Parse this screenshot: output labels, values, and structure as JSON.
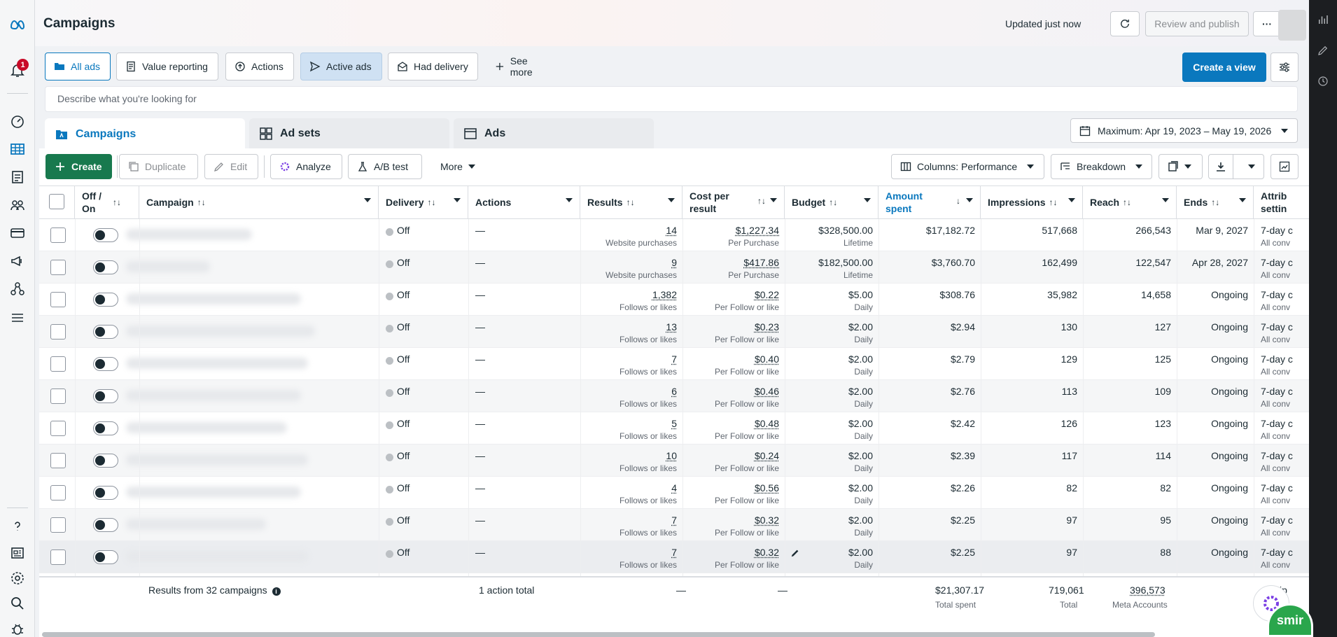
{
  "header": {
    "title": "Campaigns",
    "updated": "Updated just now",
    "review_publish": "Review and publish",
    "more_glyph": "···"
  },
  "rail": {
    "notification_count": "1",
    "icons": [
      "meta-logo-icon",
      "notification-bell-icon",
      "dashboard-gauge-icon",
      "table-grid-icon",
      "pages-icon",
      "audience-icon",
      "billing-card-icon",
      "megaphone-icon",
      "network-icon",
      "menu-icon",
      "help-icon",
      "news-icon",
      "settings-gear-icon",
      "search-icon",
      "bug-icon"
    ]
  },
  "views": {
    "items": [
      {
        "label": "All ads",
        "icon": "folder-icon",
        "selected": true
      },
      {
        "label": "Value reporting",
        "icon": "report-icon"
      },
      {
        "label": "Actions",
        "icon": "actions-icon"
      },
      {
        "label": "Active ads",
        "icon": "send-icon",
        "highlight": true
      },
      {
        "label": "Had delivery",
        "icon": "envelope-icon"
      },
      {
        "label": "See more",
        "icon": "plus-icon"
      }
    ],
    "create_view": "Create a view"
  },
  "search": {
    "placeholder": "Describe what you're looking for"
  },
  "levels": {
    "campaigns": "Campaigns",
    "adsets": "Ad sets",
    "ads": "Ads"
  },
  "date_range": "Maximum: Apr 19, 2023 – May 19, 2026",
  "toolbar": {
    "create": "Create",
    "duplicate": "Duplicate",
    "edit": "Edit",
    "analyze": "Analyze",
    "ab_test": "A/B test",
    "more": "More",
    "columns": "Columns: Performance",
    "breakdown": "Breakdown"
  },
  "columns": {
    "offon": [
      "Off /",
      "On"
    ],
    "campaign": "Campaign",
    "delivery": "Delivery",
    "actions": "Actions",
    "results": "Results",
    "cpr": [
      "Cost per",
      "result"
    ],
    "budget": "Budget",
    "amount": [
      "Amount",
      "spent"
    ],
    "impressions": "Impressions",
    "reach": "Reach",
    "ends": "Ends",
    "attrib": [
      "Attrib",
      "settin"
    ]
  },
  "rows": [
    {
      "delivery": "Off",
      "actions": "—",
      "results": "14",
      "results_sub": "Website purchases",
      "cpr": "$1,227.34",
      "cpr_sub": "Per Purchase",
      "budget": "$328,500.00",
      "budget_sub": "Lifetime",
      "amount": "$17,182.72",
      "impressions": "517,668",
      "reach": "266,543",
      "ends": "Mar 9, 2027",
      "attrib": "7-day c",
      "attrib_sub": "All conv"
    },
    {
      "delivery": "Off",
      "actions": "—",
      "results": "9",
      "results_sub": "Website purchases",
      "cpr": "$417.86",
      "cpr_sub": "Per Purchase",
      "budget": "$182,500.00",
      "budget_sub": "Lifetime",
      "amount": "$3,760.70",
      "impressions": "162,499",
      "reach": "122,547",
      "ends": "Apr 28, 2027",
      "attrib": "7-day c",
      "attrib_sub": "All conv"
    },
    {
      "delivery": "Off",
      "actions": "—",
      "results": "1,382",
      "results_sub": "Follows or likes",
      "cpr": "$0.22",
      "cpr_sub": "Per Follow or like",
      "budget": "$5.00",
      "budget_sub": "Daily",
      "amount": "$308.76",
      "impressions": "35,982",
      "reach": "14,658",
      "ends": "Ongoing",
      "attrib": "7-day c",
      "attrib_sub": "All conv"
    },
    {
      "delivery": "Off",
      "actions": "—",
      "results": "13",
      "results_sub": "Follows or likes",
      "cpr": "$0.23",
      "cpr_sub": "Per Follow or like",
      "budget": "$2.00",
      "budget_sub": "Daily",
      "amount": "$2.94",
      "impressions": "130",
      "reach": "127",
      "ends": "Ongoing",
      "attrib": "7-day c",
      "attrib_sub": "All conv"
    },
    {
      "delivery": "Off",
      "actions": "—",
      "results": "7",
      "results_sub": "Follows or likes",
      "cpr": "$0.40",
      "cpr_sub": "Per Follow or like",
      "budget": "$2.00",
      "budget_sub": "Daily",
      "amount": "$2.79",
      "impressions": "129",
      "reach": "125",
      "ends": "Ongoing",
      "attrib": "7-day c",
      "attrib_sub": "All conv"
    },
    {
      "delivery": "Off",
      "actions": "—",
      "results": "6",
      "results_sub": "Follows or likes",
      "cpr": "$0.46",
      "cpr_sub": "Per Follow or like",
      "budget": "$2.00",
      "budget_sub": "Daily",
      "amount": "$2.76",
      "impressions": "113",
      "reach": "109",
      "ends": "Ongoing",
      "attrib": "7-day c",
      "attrib_sub": "All conv"
    },
    {
      "delivery": "Off",
      "actions": "—",
      "results": "5",
      "results_sub": "Follows or likes",
      "cpr": "$0.48",
      "cpr_sub": "Per Follow or like",
      "budget": "$2.00",
      "budget_sub": "Daily",
      "amount": "$2.42",
      "impressions": "126",
      "reach": "123",
      "ends": "Ongoing",
      "attrib": "7-day c",
      "attrib_sub": "All conv"
    },
    {
      "delivery": "Off",
      "actions": "—",
      "results": "10",
      "results_sub": "Follows or likes",
      "cpr": "$0.24",
      "cpr_sub": "Per Follow or like",
      "budget": "$2.00",
      "budget_sub": "Daily",
      "amount": "$2.39",
      "impressions": "117",
      "reach": "114",
      "ends": "Ongoing",
      "attrib": "7-day c",
      "attrib_sub": "All conv"
    },
    {
      "delivery": "Off",
      "actions": "—",
      "results": "4",
      "results_sub": "Follows or likes",
      "cpr": "$0.56",
      "cpr_sub": "Per Follow or like",
      "budget": "$2.00",
      "budget_sub": "Daily",
      "amount": "$2.26",
      "impressions": "82",
      "reach": "82",
      "ends": "Ongoing",
      "attrib": "7-day c",
      "attrib_sub": "All conv"
    },
    {
      "delivery": "Off",
      "actions": "—",
      "results": "7",
      "results_sub": "Follows or likes",
      "cpr": "$0.32",
      "cpr_sub": "Per Follow or like",
      "budget": "$2.00",
      "budget_sub": "Daily",
      "amount": "$2.25",
      "impressions": "97",
      "reach": "95",
      "ends": "Ongoing",
      "attrib": "7-day c",
      "attrib_sub": "All conv"
    },
    {
      "delivery": "Off",
      "actions": "—",
      "results": "7",
      "results_sub": "Follows or likes",
      "cpr": "$0.32",
      "cpr_sub": "Per Follow or like",
      "budget": "$2.00",
      "budget_sub": "Daily",
      "amount": "$2.25",
      "impressions": "97",
      "reach": "88",
      "ends": "Ongoing",
      "attrib": "7-day c",
      "attrib_sub": "All conv"
    }
  ],
  "footer": {
    "results_label": "Results from 32 campaigns",
    "actions_total": "1 action total",
    "results_dash": "—",
    "cpr_dash": "—",
    "amount": "$21,307.17",
    "amount_sub": "Total spent",
    "impressions": "719,061",
    "impressions_sub": "Total",
    "reach": "396,573",
    "reach_sub": "Meta Accounts",
    "attrib": "ltip"
  },
  "assistant_badge": "smir",
  "colors": {
    "accent": "#0a78be",
    "create_green": "#18794e",
    "badge_red": "#c80a28"
  }
}
